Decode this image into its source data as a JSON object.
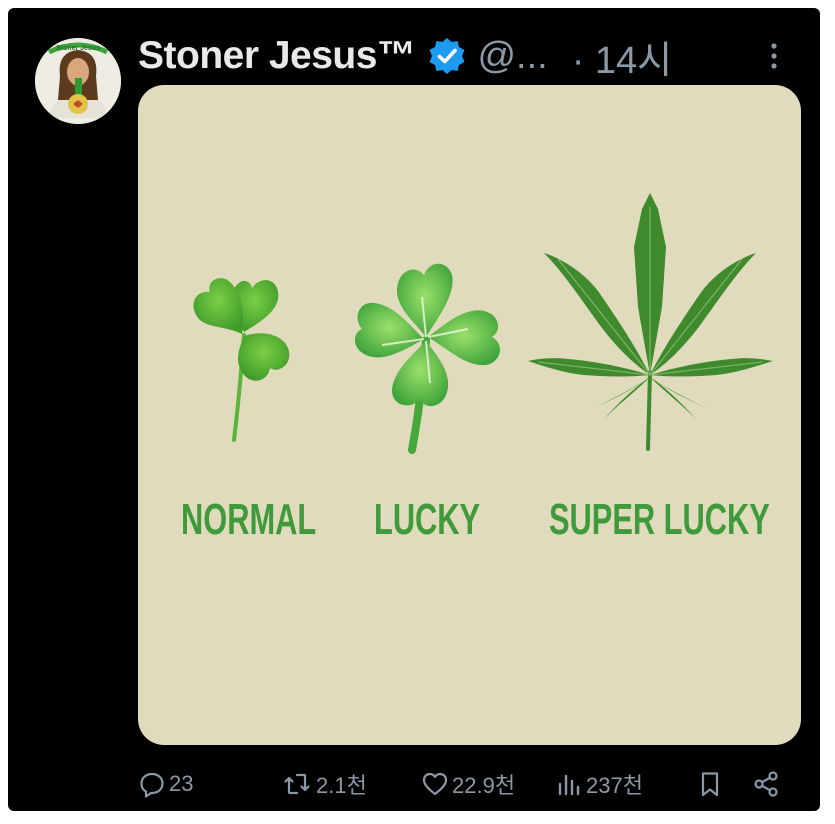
{
  "tweet": {
    "author_name": "Stoner Jesus™",
    "handle": "@...",
    "separator": "·",
    "time": "14시",
    "avatar": {
      "badge_text": "Stoner Jesus"
    }
  },
  "media": {
    "background_color": "#e1dbbd",
    "label_color": "#3f9a3b",
    "panels": [
      {
        "label": "NORMAL",
        "plant": "three-leaf-clover-icon"
      },
      {
        "label": "LUCKY",
        "plant": "four-leaf-clover-icon"
      },
      {
        "label": "SUPER LUCKY",
        "plant": "cannabis-leaf-icon"
      }
    ]
  },
  "actions": {
    "reply_count": "23",
    "retweet_count": "2.1천",
    "like_count": "22.9천",
    "view_count": "237천"
  },
  "colors": {
    "background": "#000000",
    "primary_text": "#e7e9ea",
    "secondary_text": "#8b98a5",
    "verified": "#1d9bf0"
  }
}
